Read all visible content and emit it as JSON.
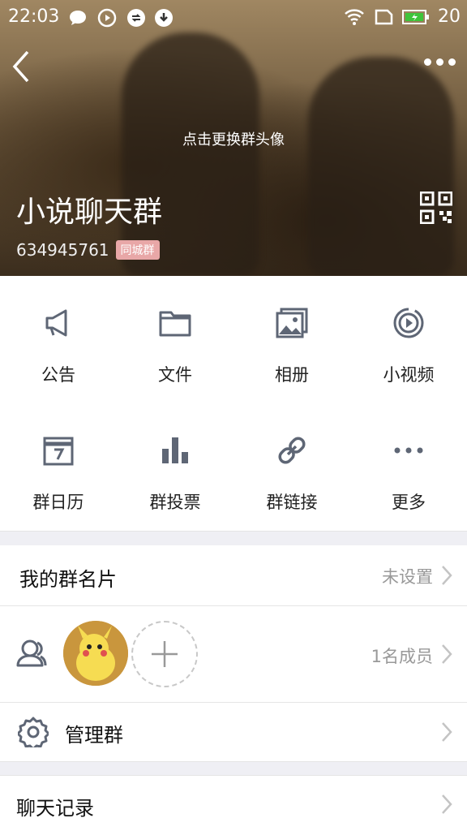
{
  "status_bar": {
    "time": "22:03",
    "battery": "20"
  },
  "header": {
    "change_avatar_hint": "点击更换群头像",
    "group_name": "小说聊天群",
    "group_id": "634945761",
    "group_tag": "同城群"
  },
  "features": [
    {
      "label": "公告",
      "icon": "megaphone-icon"
    },
    {
      "label": "文件",
      "icon": "folder-icon"
    },
    {
      "label": "相册",
      "icon": "photo-album-icon"
    },
    {
      "label": "小视频",
      "icon": "video-icon"
    },
    {
      "label": "群日历",
      "icon": "calendar-icon"
    },
    {
      "label": "群投票",
      "icon": "bar-chart-icon"
    },
    {
      "label": "群链接",
      "icon": "link-icon"
    },
    {
      "label": "更多",
      "icon": "more-icon"
    }
  ],
  "rows": {
    "group_card": {
      "title": "我的群名片",
      "value": "未设置"
    },
    "members": {
      "value": "1名成员"
    },
    "manage": {
      "title": "管理群"
    },
    "chat_history": {
      "title": "聊天记录"
    }
  },
  "colors": {
    "icon": "#5e6675",
    "accent": "#e8a7a7"
  }
}
